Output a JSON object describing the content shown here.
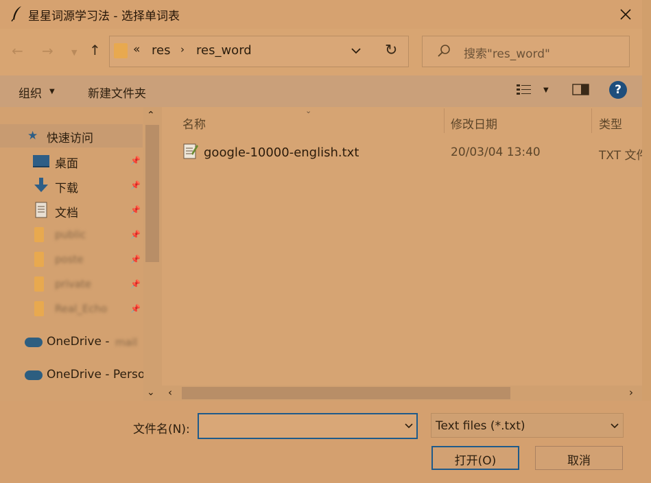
{
  "window": {
    "title": "星星词源学习法 - 选择单词表"
  },
  "icons": {
    "app": "feather-icon",
    "close": "close-icon",
    "back": "arrow-left-icon",
    "forward": "arrow-right-icon",
    "up": "arrow-up-icon",
    "refresh": "refresh-icon",
    "search": "search-icon",
    "help": "help-icon"
  },
  "address": {
    "overflow": "«",
    "crumbs": [
      "res",
      "res_word"
    ],
    "separator": "›"
  },
  "search": {
    "placeholder": "搜索\"res_word\""
  },
  "toolbar": {
    "organize": "组织",
    "new_folder": "新建文件夹",
    "help": "?"
  },
  "nav": {
    "quick_access": "快速访问",
    "items": [
      {
        "label": "桌面",
        "icon": "desktop-icon",
        "pinned": true
      },
      {
        "label": "下载",
        "icon": "download-icon",
        "pinned": true
      },
      {
        "label": "文档",
        "icon": "document-icon",
        "pinned": true
      },
      {
        "label": "public",
        "icon": "folder-icon",
        "pinned": true
      },
      {
        "label": "poste",
        "icon": "folder-icon",
        "pinned": true
      },
      {
        "label": "private",
        "icon": "folder-icon",
        "pinned": true
      },
      {
        "label": "Real_Echo",
        "icon": "folder-icon",
        "pinned": true
      }
    ],
    "onedrive1": "OneDrive - ",
    "onedrive1_blur": "mail",
    "onedrive2": "OneDrive - Perso"
  },
  "columns": {
    "name": "名称",
    "modified": "修改日期",
    "type": "类型"
  },
  "files": [
    {
      "name": "google-10000-english.txt",
      "modified": "20/03/04 13:40",
      "type": "TXT 文件"
    }
  ],
  "footer": {
    "filename_label": "文件名(N):",
    "filename_value": "",
    "filetype": "Text files (*.txt)",
    "open": "打开(O)",
    "cancel": "取消"
  },
  "colors": {
    "accent": "#1e5a8a",
    "background": "#d4a06f"
  }
}
